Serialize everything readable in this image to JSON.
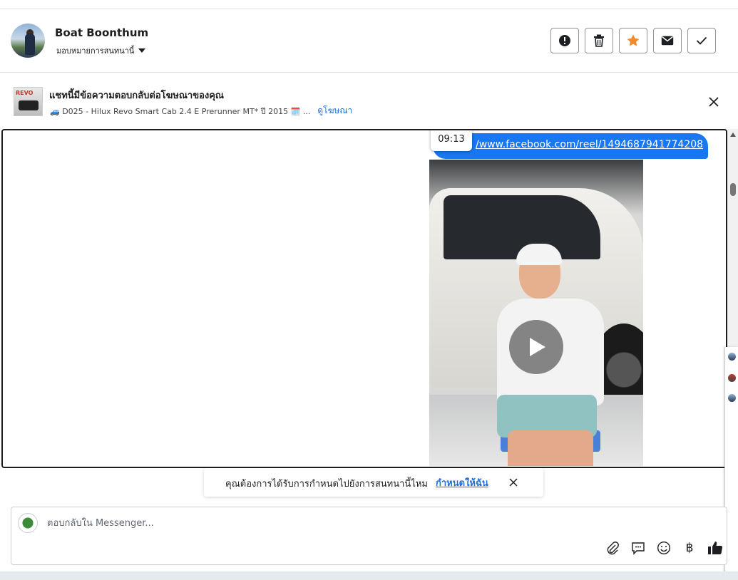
{
  "header": {
    "contact_name": "Boat Boonthum",
    "assign_label": "มอบหมายการสนทนานี้",
    "actions": [
      {
        "name": "spam-button",
        "icon": "alert-icon"
      },
      {
        "name": "delete-button",
        "icon": "trash-icon"
      },
      {
        "name": "star-button",
        "icon": "star-icon",
        "color": "#f28c28"
      },
      {
        "name": "mark-unread-button",
        "icon": "envelope-icon"
      },
      {
        "name": "mark-done-button",
        "icon": "check-icon"
      }
    ]
  },
  "ad_banner": {
    "title": "แชทนี้มีข้อความตอบกลับต่อโฆษณาของคุณ",
    "subtitle": "🚙 D025 - Hilux Revo Smart Cab 2.4 E Prerunner MT* ปี 2015 🗓️ ...",
    "link_label": "ดูโฆษณา",
    "thumb_text": "REVO"
  },
  "message": {
    "link_text": "/www.facebook.com/reel/1494687941774208",
    "timestamp": "09:13"
  },
  "suggestion": {
    "text": "คุณต้องการได้รับการกำหนดไปยังการสนทนานี้ไหม",
    "link": "กำหนดให้ฉัน"
  },
  "composer": {
    "placeholder": "ตอบกลับใน Messenger...",
    "currency_symbol": "฿"
  },
  "colors": {
    "accent": "#1877f2",
    "link": "#216fdb",
    "star": "#f28c28"
  }
}
